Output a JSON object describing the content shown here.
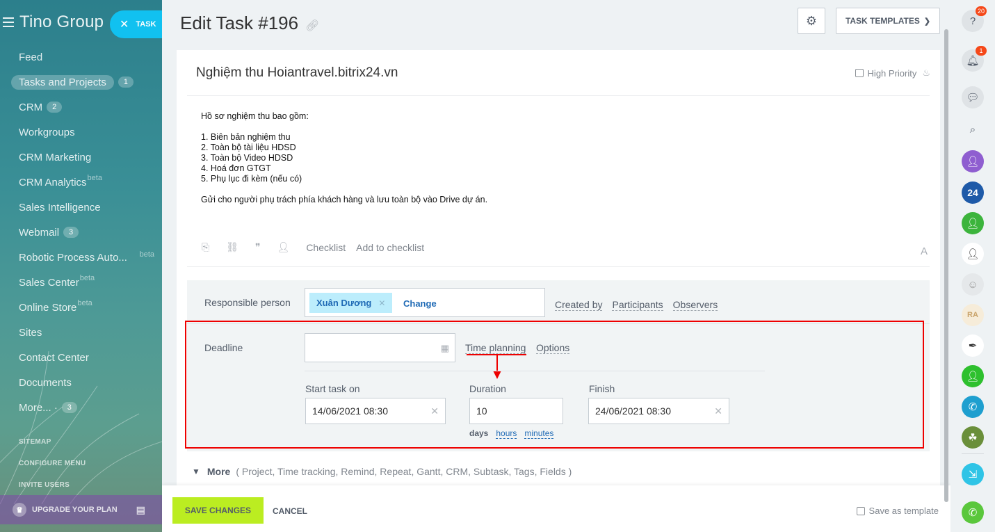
{
  "sidebar": {
    "brand": "Tino Group",
    "task_pill": "TASK",
    "items": [
      {
        "label": "Feed",
        "count": ""
      },
      {
        "label": "Tasks and Projects",
        "count": "1"
      },
      {
        "label": "CRM",
        "count": "2"
      },
      {
        "label": "Workgroups",
        "count": ""
      },
      {
        "label": "CRM Marketing",
        "count": ""
      },
      {
        "label": "CRM Analytics",
        "count": "",
        "badge": "beta"
      },
      {
        "label": "Sales Intelligence",
        "count": ""
      },
      {
        "label": "Webmail",
        "count": "3"
      },
      {
        "label": "Robotic Process Auto...",
        "count": "",
        "badge": "beta"
      },
      {
        "label": "Sales Center",
        "count": "",
        "badge": "beta"
      },
      {
        "label": "Online Store",
        "count": "",
        "badge": "beta"
      },
      {
        "label": "Sites",
        "count": ""
      },
      {
        "label": "Contact Center",
        "count": ""
      },
      {
        "label": "Documents",
        "count": ""
      },
      {
        "label": "More... ·",
        "count": "3"
      }
    ],
    "sitemap": "SITEMAP",
    "configure_menu": "CONFIGURE MENU",
    "invite_users": "INVITE USERS",
    "upgrade": "UPGRADE YOUR PLAN"
  },
  "header": {
    "title": "Edit Task #196",
    "templates_label": "TASK TEMPLATES"
  },
  "task": {
    "title": "Nghiệm thu Hoiantravel.bitrix24.vn",
    "high_priority": "High Priority",
    "description": {
      "intro": "Hồ sơ nghiệm thu bao gồm:",
      "items": [
        "1. Biên bản nghiệm thu",
        "2. Toàn bộ tài liệu HDSD",
        "3. Toàn bộ Video HDSD",
        "4. Hoá đơn GTGT",
        "5. Phụ lục đi kèm (nếu có)"
      ],
      "closing": "Gửi cho người phụ trách phía khách hàng và lưu toàn bộ vào Drive dự án."
    },
    "toolbar": {
      "checklist": "Checklist",
      "add_to_checklist": "Add to checklist",
      "font": "A"
    }
  },
  "options": {
    "responsible_label": "Responsible person",
    "responsible_name": "Xuân Dương",
    "change": "Change",
    "created_by": "Created by",
    "participants": "Participants",
    "observers": "Observers",
    "deadline_label": "Deadline",
    "deadline_value": "",
    "time_planning": "Time planning",
    "options_link": "Options",
    "start_label": "Start task on",
    "start_value": "14/06/2021 08:30",
    "duration_label": "Duration",
    "duration_value": "10",
    "finish_label": "Finish",
    "finish_value": "24/06/2021 08:30",
    "unit_days": "days",
    "unit_hours": "hours",
    "unit_minutes": "minutes"
  },
  "more": {
    "label": "More",
    "items": "( Project,  Time tracking,  Remind,  Repeat,  Gantt,  CRM,  Subtask,  Tags,  Fields )"
  },
  "footer": {
    "save": "SAVE CHANGES",
    "cancel": "CANCEL",
    "save_template": "Save as template"
  },
  "rail": {
    "help_badge": "20",
    "notif_badge": "1",
    "accent_green": "#bbed21",
    "accent_blue": "#1f6ab5",
    "highlight_red": "#e00000"
  }
}
